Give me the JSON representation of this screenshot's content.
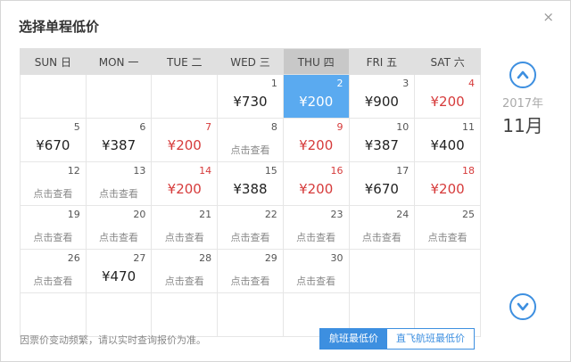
{
  "dialog": {
    "title": "选择单程低价",
    "close_symbol": "×"
  },
  "weekdays": [
    "SUN 日",
    "MON 一",
    "TUE 二",
    "WED 三",
    "THU 四",
    "FRI 五",
    "SAT 六"
  ],
  "calendar": {
    "year": "2017年",
    "month": "11月",
    "weeks": [
      [
        {},
        {},
        {},
        {
          "day": "1",
          "price": "¥730"
        },
        {
          "day": "2",
          "price": "¥200",
          "selected": true
        },
        {
          "day": "3",
          "price": "¥900"
        },
        {
          "day": "4",
          "price": "¥200",
          "weekend": true,
          "low": true
        }
      ],
      [
        {
          "day": "5",
          "price": "¥670"
        },
        {
          "day": "6",
          "price": "¥387"
        },
        {
          "day": "7",
          "price": "¥200",
          "weekend": true,
          "low": true
        },
        {
          "day": "8",
          "price": "点击查看",
          "query": true
        },
        {
          "day": "9",
          "price": "¥200",
          "weekend": true,
          "low": true
        },
        {
          "day": "10",
          "price": "¥387"
        },
        {
          "day": "11",
          "price": "¥400"
        }
      ],
      [
        {
          "day": "12",
          "price": "点击查看",
          "query": true
        },
        {
          "day": "13",
          "price": "点击查看",
          "query": true
        },
        {
          "day": "14",
          "price": "¥200",
          "weekend": true,
          "low": true
        },
        {
          "day": "15",
          "price": "¥388"
        },
        {
          "day": "16",
          "price": "¥200",
          "weekend": true,
          "low": true
        },
        {
          "day": "17",
          "price": "¥670"
        },
        {
          "day": "18",
          "price": "¥200",
          "weekend": true,
          "low": true
        }
      ],
      [
        {
          "day": "19",
          "price": "点击查看",
          "query": true
        },
        {
          "day": "20",
          "price": "点击查看",
          "query": true
        },
        {
          "day": "21",
          "price": "点击查看",
          "query": true
        },
        {
          "day": "22",
          "price": "点击查看",
          "query": true
        },
        {
          "day": "23",
          "price": "点击查看",
          "query": true
        },
        {
          "day": "24",
          "price": "点击查看",
          "query": true
        },
        {
          "day": "25",
          "price": "点击查看",
          "query": true
        }
      ],
      [
        {
          "day": "26",
          "price": "点击查看",
          "query": true
        },
        {
          "day": "27",
          "price": "¥470"
        },
        {
          "day": "28",
          "price": "点击查看",
          "query": true
        },
        {
          "day": "29",
          "price": "点击查看",
          "query": true
        },
        {
          "day": "30",
          "price": "点击查看",
          "query": true
        },
        {},
        {}
      ],
      [
        {},
        {},
        {},
        {},
        {},
        {},
        {}
      ]
    ]
  },
  "nav": {
    "prev_icon": "chevron-up-circle-icon",
    "next_icon": "chevron-down-circle-icon",
    "accent": "#3d8fe0"
  },
  "footer": {
    "note": "因票价变动频繁，请以实时查询报价为准。",
    "tabs": [
      "航班最低价",
      "直飞航班最低价"
    ]
  }
}
